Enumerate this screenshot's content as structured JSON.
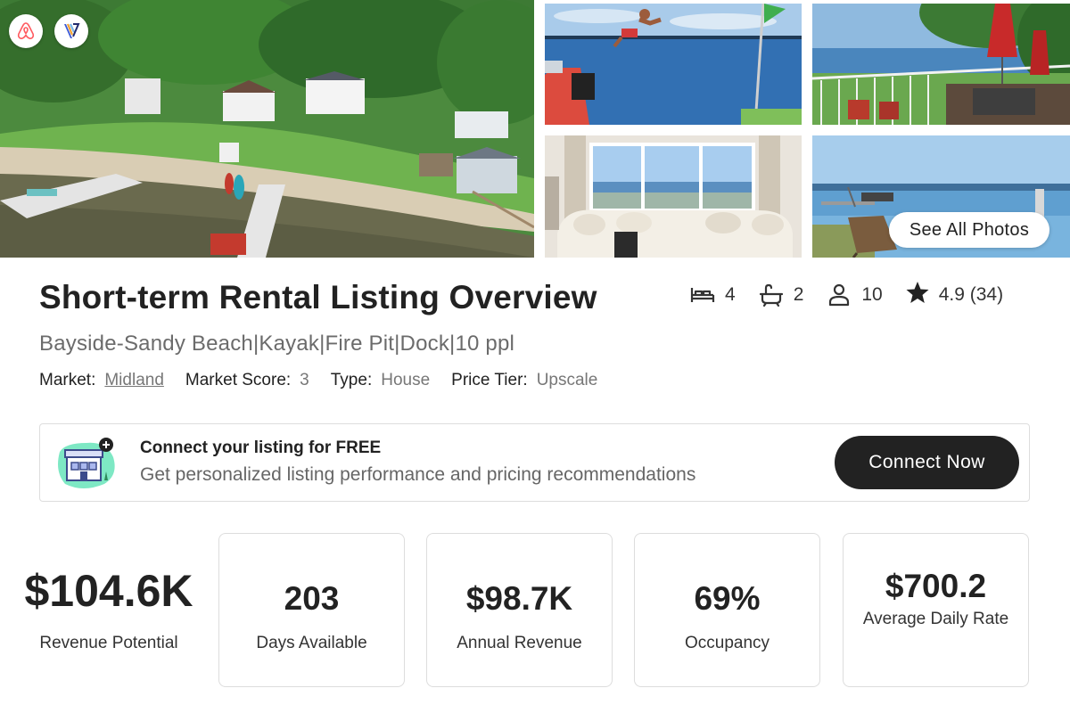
{
  "gallery": {
    "see_all_label": "See All Photos",
    "photos": [
      "lake-house-aerial",
      "lake-jump",
      "deck-umbrellas",
      "living-room-lake-view",
      "lake-dock-chair"
    ]
  },
  "badges": {
    "airbnb_icon": "airbnb-logo-icon",
    "vrbo_icon": "vrbo-logo-icon"
  },
  "listing": {
    "title": "Short-term Rental Listing Overview",
    "subtitle": "Bayside-Sandy Beach|Kayak|Fire Pit|Dock|10 ppl",
    "market_label": "Market:",
    "market_value": "Midland",
    "score_label": "Market Score:",
    "score_value": "3",
    "type_label": "Type:",
    "type_value": "House",
    "tier_label": "Price Tier:",
    "tier_value": "Upscale"
  },
  "stats": {
    "bedrooms": "4",
    "bathrooms": "2",
    "guests": "10",
    "rating": "4.9 (34)"
  },
  "banner": {
    "title": "Connect your listing for FREE",
    "text": "Get personalized listing performance and pricing recommendations",
    "button_label": "Connect Now"
  },
  "metrics": {
    "revenue_potential": {
      "value": "$104.6K",
      "label": "Revenue Potential"
    },
    "days_available": {
      "value": "203",
      "label": "Days Available"
    },
    "annual_revenue": {
      "value": "$98.7K",
      "label": "Annual Revenue"
    },
    "occupancy": {
      "value": "69%",
      "label": "Occupancy"
    },
    "average_daily_rate": {
      "value": "$700.2",
      "label": "Average Daily Rate"
    }
  },
  "colors": {
    "text_dark": "#222222",
    "text_muted": "#6b6b6b",
    "button_dark": "#222222",
    "airbnb": "#ff5a5f",
    "illustration_mint": "#7ee8c4"
  }
}
